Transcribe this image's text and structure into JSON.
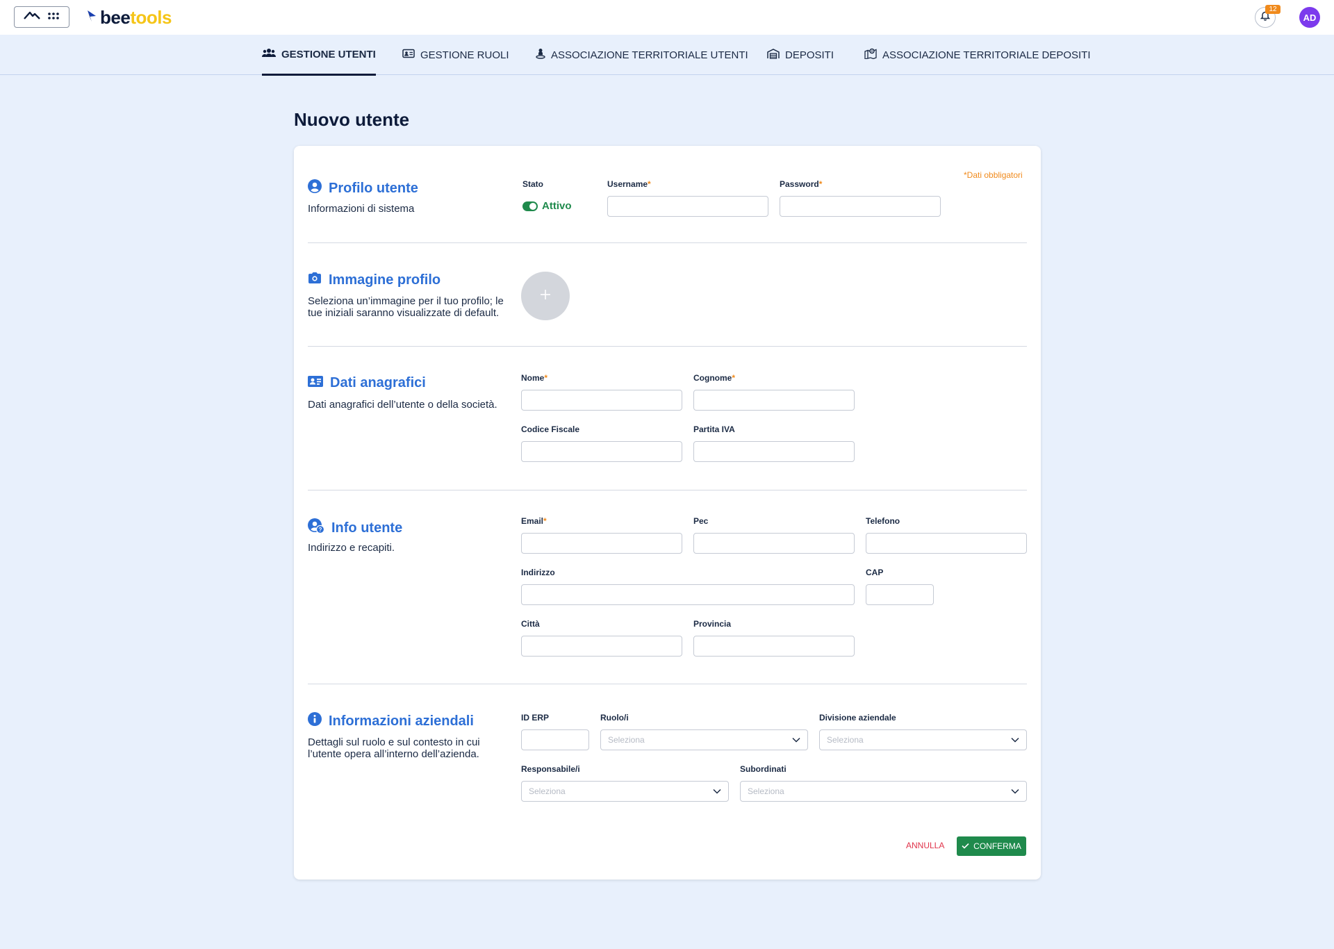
{
  "brand": {
    "logo_bee": "bee",
    "logo_tools": "tools",
    "accent_color": "#2d6fd6",
    "brand_yellow": "#f5c518"
  },
  "header": {
    "notification_count": "12",
    "avatar_initials": "AD"
  },
  "nav": {
    "tabs": [
      {
        "label": "GESTIONE UTENTI",
        "icon": "users-icon",
        "active": true
      },
      {
        "label": "GESTIONE RUOLI",
        "icon": "id-badge-icon",
        "active": false
      },
      {
        "label": "ASSOCIAZIONE TERRITORIALE UTENTI",
        "icon": "person-location-icon",
        "active": false
      },
      {
        "label": "DEPOSITI",
        "icon": "warehouse-icon",
        "active": false
      },
      {
        "label": "ASSOCIAZIONE TERRITORIALE DEPOSITI",
        "icon": "map-location-icon",
        "active": false
      }
    ]
  },
  "page": {
    "title": "Nuovo utente",
    "required_note": "*Dati obbligatori"
  },
  "sections": {
    "profile": {
      "title": "Profilo utente",
      "desc": "Informazioni di sistema",
      "status_label": "Stato",
      "status_value": "Attivo",
      "username_label": "Username",
      "username_value": "",
      "password_label": "Password",
      "password_value": ""
    },
    "image": {
      "title": "Immagine profilo",
      "desc": "Seleziona un’immagine per il tuo profilo; le tue iniziali saranno visualizzate di default."
    },
    "anagrafica": {
      "title": "Dati anagrafici",
      "desc": "Dati anagrafici dell’utente o della società.",
      "nome_label": "Nome",
      "cognome_label": "Cognome",
      "cf_label": "Codice Fiscale",
      "piva_label": "Partita IVA"
    },
    "info": {
      "title": "Info utente",
      "desc": "Indirizzo e recapiti.",
      "email_label": "Email",
      "pec_label": "Pec",
      "telefono_label": "Telefono",
      "indirizzo_label": "Indirizzo",
      "cap_label": "CAP",
      "citta_label": "Città",
      "provincia_label": "Provincia"
    },
    "azienda": {
      "title": "Informazioni aziendali",
      "desc": "Dettagli sul ruolo e sul contesto in cui l’utente opera all’interno dell’azienda.",
      "iderp_label": "ID ERP",
      "ruoli_label": "Ruolo/i",
      "divisione_label": "Divisione aziendale",
      "responsabili_label": "Responsabile/i",
      "subordinati_label": "Subordinati",
      "select_placeholder": "Seleziona"
    }
  },
  "actions": {
    "cancel_label": "ANNULLA",
    "confirm_label": "CONFERMA"
  }
}
